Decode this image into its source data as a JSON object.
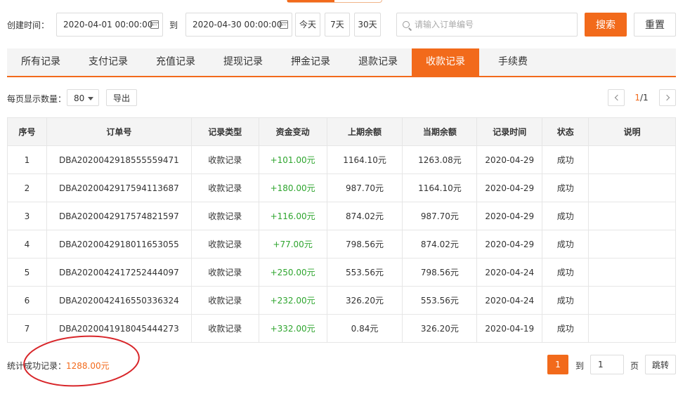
{
  "filter": {
    "created_label": "创建时间：",
    "start_date": "2020-04-01 00:00:00",
    "to_label": "到",
    "end_date": "2020-04-30 00:00:00",
    "quick": [
      "今天",
      "7天",
      "30天"
    ],
    "search_placeholder": "请输入订单编号",
    "search_value": "",
    "search_button": "搜索",
    "reset_button": "重置"
  },
  "tabs": {
    "items": [
      "所有记录",
      "支付记录",
      "充值记录",
      "提现记录",
      "押金记录",
      "退款记录",
      "收款记录",
      "手续费"
    ],
    "active": "收款记录"
  },
  "toolbar": {
    "per_page_label": "每页显示数量：",
    "per_page_value": "80",
    "export_label": "导出",
    "page_current": "1",
    "page_total": "/1"
  },
  "table": {
    "headers": [
      "序号",
      "订单号",
      "记录类型",
      "资金变动",
      "上期余额",
      "当期余额",
      "记录时间",
      "状态",
      "说明"
    ],
    "rows": [
      [
        "1",
        "DBA2020042918555559471",
        "收款记录",
        "+101.00元",
        "1164.10元",
        "1263.08元",
        "2020-04-29",
        "成功",
        ""
      ],
      [
        "2",
        "DBA2020042917594113687",
        "收款记录",
        "+180.00元",
        "987.70元",
        "1164.10元",
        "2020-04-29",
        "成功",
        ""
      ],
      [
        "3",
        "DBA2020042917574821597",
        "收款记录",
        "+116.00元",
        "874.02元",
        "987.70元",
        "2020-04-29",
        "成功",
        ""
      ],
      [
        "4",
        "DBA2020042918011653055",
        "收款记录",
        "+77.00元",
        "798.56元",
        "874.02元",
        "2020-04-29",
        "成功",
        ""
      ],
      [
        "5",
        "DBA2020042417252444097",
        "收款记录",
        "+250.00元",
        "553.56元",
        "798.56元",
        "2020-04-24",
        "成功",
        ""
      ],
      [
        "6",
        "DBA2020042416550336324",
        "收款记录",
        "+232.00元",
        "326.20元",
        "553.56元",
        "2020-04-24",
        "成功",
        ""
      ],
      [
        "7",
        "DBA2020041918045444273",
        "收款记录",
        "+332.00元",
        "0.84元",
        "326.20元",
        "2020-04-19",
        "成功",
        ""
      ]
    ]
  },
  "footer": {
    "summary_label": "统计成功记录：",
    "summary_amount": "1288.00元",
    "current_page": "1",
    "goto_label": "到",
    "goto_value": "1",
    "page_unit": "页",
    "jump_button": "跳转"
  },
  "colors": {
    "accent": "#f26a1b",
    "positive": "#2ea52e",
    "annotation": "#d8262a"
  }
}
